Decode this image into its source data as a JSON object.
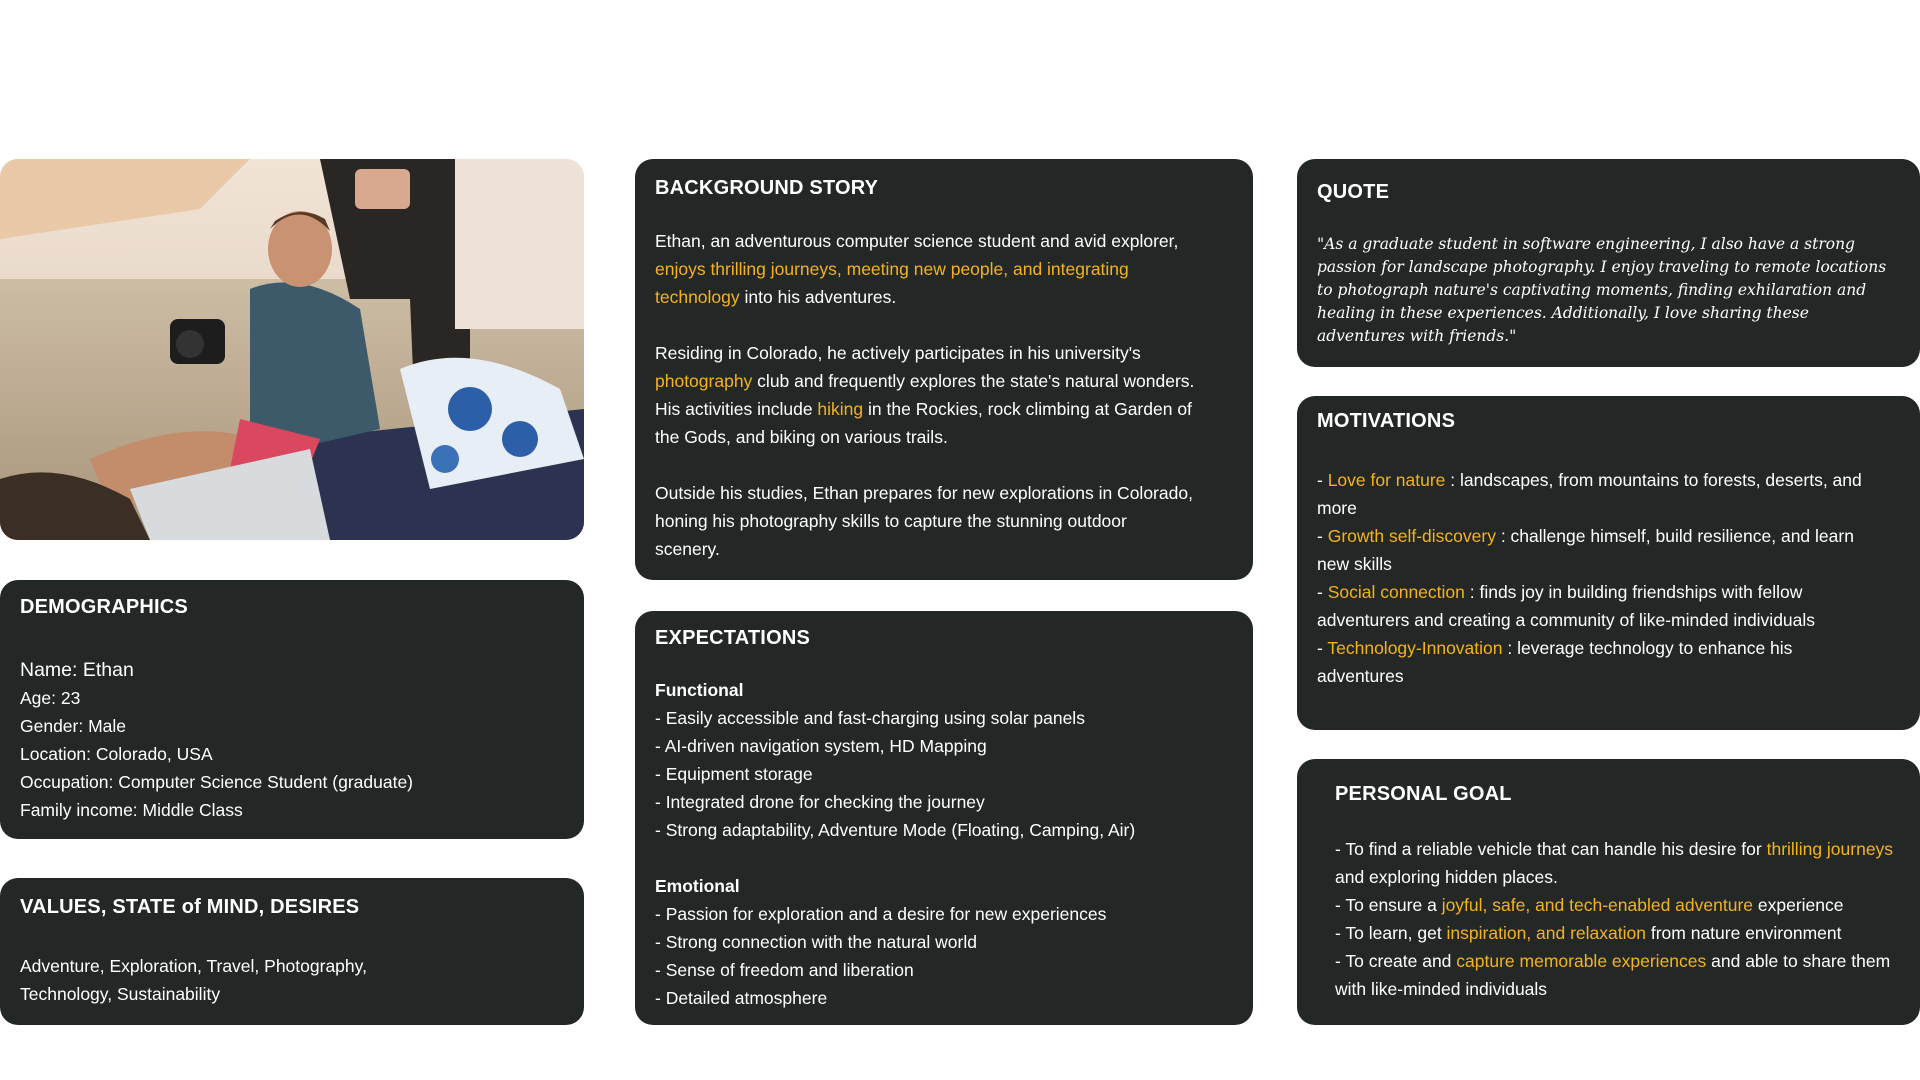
{
  "demographics": {
    "title": "DEMOGRAPHICS",
    "name": "Name: Ethan",
    "lines": [
      "Age: 23",
      "Gender: Male",
      "Location: Colorado, USA",
      "Occupation: Computer Science Student (graduate)",
      "Family income: Middle Class"
    ]
  },
  "values": {
    "title": "VALUES, STATE of MIND, DESIRES",
    "line1": "Adventure, Exploration, Travel, Photography,",
    "line2": "Technology, Sustainability"
  },
  "background": {
    "title": "BACKGROUND STORY",
    "p1_a": "Ethan, an adventurous computer science student and avid explorer, ",
    "p1_hl": "enjoys thrilling journeys, meeting new people, and integrating technology",
    "p1_b": " into his adventures.",
    "p2_a": "Residing in Colorado, he actively participates in his university's ",
    "p2_hl1": "photography",
    "p2_b": " club and frequently explores the state's natural wonders. His activities include ",
    "p2_hl2": "hiking",
    "p2_c": " in the Rockies, rock climbing at Garden of the Gods, and biking on various trails.",
    "p3": "Outside his studies, Ethan prepares for new explorations in Colorado, honing his photography skills to capture the stunning outdoor scenery."
  },
  "expectations": {
    "title": "EXPECTATIONS",
    "functional_title": "Functional",
    "functional": [
      "- Easily accessible and fast-charging using solar panels",
      "- AI-driven navigation system, HD Mapping",
      "- Equipment storage",
      "- Integrated drone for checking the journey",
      "- Strong adaptability, Adventure Mode (Floating, Camping, Air)"
    ],
    "emotional_title": "Emotional",
    "emotional": [
      "- Passion for exploration and a desire for new experiences",
      "- Strong connection with the natural world",
      "- Sense of freedom and liberation",
      "- Detailed atmosphere"
    ]
  },
  "quote": {
    "title": "QUOTE",
    "text": "\"As a graduate student in software engineering, I also have a strong passion for landscape photography. I enjoy traveling to remote locations to photograph nature's captivating moments, finding exhilaration and healing in these experiences. Additionally, I love sharing these adventures with friends.\""
  },
  "motivations": {
    "title": "MOTIVATIONS",
    "items": [
      {
        "prefix": "- ",
        "hl": "Love for nature",
        "rest": " : landscapes, from mountains to forests, deserts, and more"
      },
      {
        "prefix": "- ",
        "hl": "Growth self-discovery",
        "rest": " : challenge himself, build resilience, and learn new skills"
      },
      {
        "prefix": "- ",
        "hl": "Social connection",
        "rest": " : finds joy in building friendships with fellow adventurers and creating a community of like-minded individuals"
      },
      {
        "prefix": "- ",
        "hl": "Technology-Innovation",
        "rest": " : leverage technology to enhance his adventures"
      }
    ]
  },
  "goal": {
    "title": "PERSONAL GOAL",
    "i1_a": "- To find a reliable vehicle that can handle his desire for ",
    "i1_hl": "thrilling journeys",
    "i1_b": " and exploring hidden places.",
    "i2_a": "- To ensure a ",
    "i2_hl": "joyful, safe, and tech-enabled adventure",
    "i2_b": " experience",
    "i3_a": "- To learn, get ",
    "i3_hl": "inspiration, and relaxation",
    "i3_b": " from nature environment",
    "i4_a": "- To create and ",
    "i4_hl": "capture memorable experiences",
    "i4_b": " and able to share them with like-minded individuals"
  },
  "colors": {
    "card_bg": "#232826",
    "highlight": "#f4b21e",
    "text": "#ffffff"
  }
}
